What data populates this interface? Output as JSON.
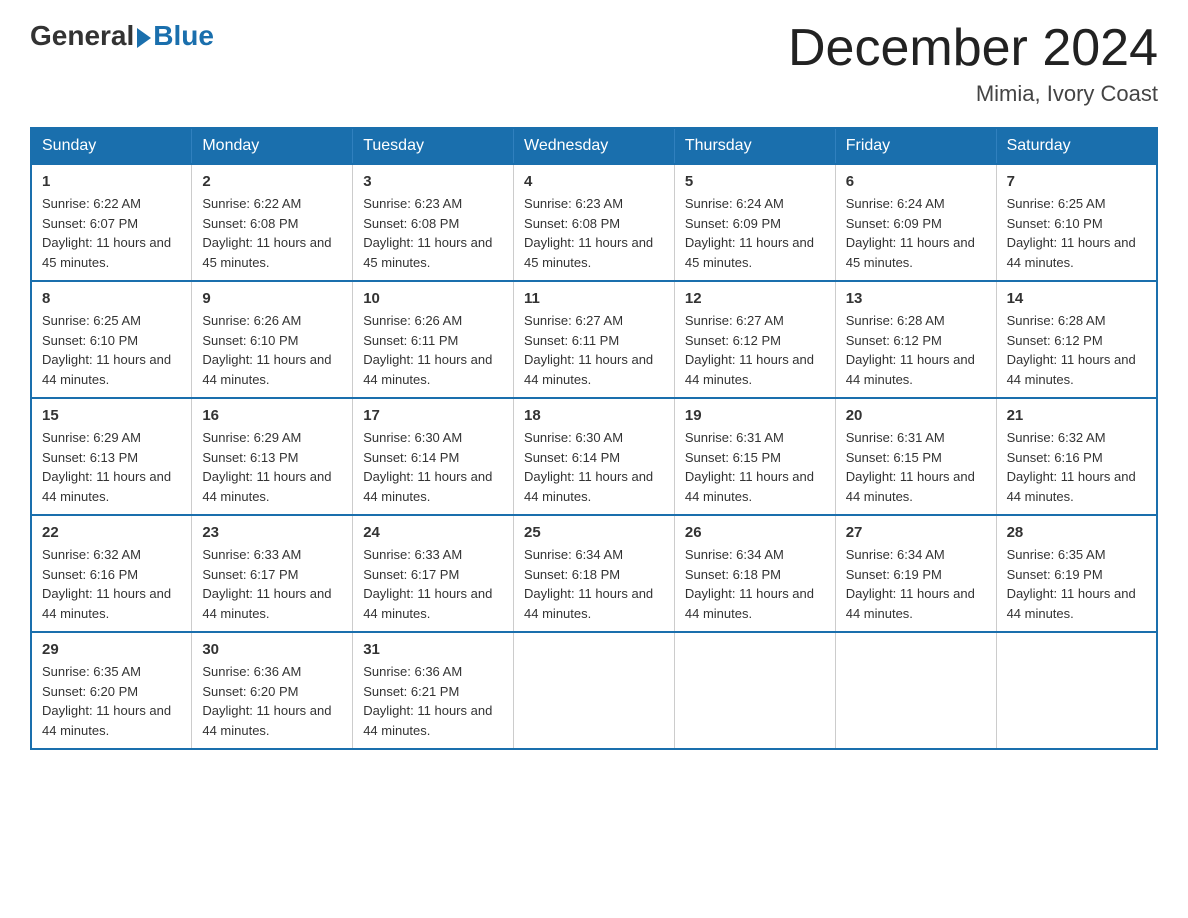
{
  "logo": {
    "general": "General",
    "blue": "Blue"
  },
  "title": "December 2024",
  "location": "Mimia, Ivory Coast",
  "days_of_week": [
    "Sunday",
    "Monday",
    "Tuesday",
    "Wednesday",
    "Thursday",
    "Friday",
    "Saturday"
  ],
  "weeks": [
    [
      {
        "day": "1",
        "sunrise": "6:22 AM",
        "sunset": "6:07 PM",
        "daylight": "11 hours and 45 minutes."
      },
      {
        "day": "2",
        "sunrise": "6:22 AM",
        "sunset": "6:08 PM",
        "daylight": "11 hours and 45 minutes."
      },
      {
        "day": "3",
        "sunrise": "6:23 AM",
        "sunset": "6:08 PM",
        "daylight": "11 hours and 45 minutes."
      },
      {
        "day": "4",
        "sunrise": "6:23 AM",
        "sunset": "6:08 PM",
        "daylight": "11 hours and 45 minutes."
      },
      {
        "day": "5",
        "sunrise": "6:24 AM",
        "sunset": "6:09 PM",
        "daylight": "11 hours and 45 minutes."
      },
      {
        "day": "6",
        "sunrise": "6:24 AM",
        "sunset": "6:09 PM",
        "daylight": "11 hours and 45 minutes."
      },
      {
        "day": "7",
        "sunrise": "6:25 AM",
        "sunset": "6:10 PM",
        "daylight": "11 hours and 44 minutes."
      }
    ],
    [
      {
        "day": "8",
        "sunrise": "6:25 AM",
        "sunset": "6:10 PM",
        "daylight": "11 hours and 44 minutes."
      },
      {
        "day": "9",
        "sunrise": "6:26 AM",
        "sunset": "6:10 PM",
        "daylight": "11 hours and 44 minutes."
      },
      {
        "day": "10",
        "sunrise": "6:26 AM",
        "sunset": "6:11 PM",
        "daylight": "11 hours and 44 minutes."
      },
      {
        "day": "11",
        "sunrise": "6:27 AM",
        "sunset": "6:11 PM",
        "daylight": "11 hours and 44 minutes."
      },
      {
        "day": "12",
        "sunrise": "6:27 AM",
        "sunset": "6:12 PM",
        "daylight": "11 hours and 44 minutes."
      },
      {
        "day": "13",
        "sunrise": "6:28 AM",
        "sunset": "6:12 PM",
        "daylight": "11 hours and 44 minutes."
      },
      {
        "day": "14",
        "sunrise": "6:28 AM",
        "sunset": "6:12 PM",
        "daylight": "11 hours and 44 minutes."
      }
    ],
    [
      {
        "day": "15",
        "sunrise": "6:29 AM",
        "sunset": "6:13 PM",
        "daylight": "11 hours and 44 minutes."
      },
      {
        "day": "16",
        "sunrise": "6:29 AM",
        "sunset": "6:13 PM",
        "daylight": "11 hours and 44 minutes."
      },
      {
        "day": "17",
        "sunrise": "6:30 AM",
        "sunset": "6:14 PM",
        "daylight": "11 hours and 44 minutes."
      },
      {
        "day": "18",
        "sunrise": "6:30 AM",
        "sunset": "6:14 PM",
        "daylight": "11 hours and 44 minutes."
      },
      {
        "day": "19",
        "sunrise": "6:31 AM",
        "sunset": "6:15 PM",
        "daylight": "11 hours and 44 minutes."
      },
      {
        "day": "20",
        "sunrise": "6:31 AM",
        "sunset": "6:15 PM",
        "daylight": "11 hours and 44 minutes."
      },
      {
        "day": "21",
        "sunrise": "6:32 AM",
        "sunset": "6:16 PM",
        "daylight": "11 hours and 44 minutes."
      }
    ],
    [
      {
        "day": "22",
        "sunrise": "6:32 AM",
        "sunset": "6:16 PM",
        "daylight": "11 hours and 44 minutes."
      },
      {
        "day": "23",
        "sunrise": "6:33 AM",
        "sunset": "6:17 PM",
        "daylight": "11 hours and 44 minutes."
      },
      {
        "day": "24",
        "sunrise": "6:33 AM",
        "sunset": "6:17 PM",
        "daylight": "11 hours and 44 minutes."
      },
      {
        "day": "25",
        "sunrise": "6:34 AM",
        "sunset": "6:18 PM",
        "daylight": "11 hours and 44 minutes."
      },
      {
        "day": "26",
        "sunrise": "6:34 AM",
        "sunset": "6:18 PM",
        "daylight": "11 hours and 44 minutes."
      },
      {
        "day": "27",
        "sunrise": "6:34 AM",
        "sunset": "6:19 PM",
        "daylight": "11 hours and 44 minutes."
      },
      {
        "day": "28",
        "sunrise": "6:35 AM",
        "sunset": "6:19 PM",
        "daylight": "11 hours and 44 minutes."
      }
    ],
    [
      {
        "day": "29",
        "sunrise": "6:35 AM",
        "sunset": "6:20 PM",
        "daylight": "11 hours and 44 minutes."
      },
      {
        "day": "30",
        "sunrise": "6:36 AM",
        "sunset": "6:20 PM",
        "daylight": "11 hours and 44 minutes."
      },
      {
        "day": "31",
        "sunrise": "6:36 AM",
        "sunset": "6:21 PM",
        "daylight": "11 hours and 44 minutes."
      },
      null,
      null,
      null,
      null
    ]
  ]
}
